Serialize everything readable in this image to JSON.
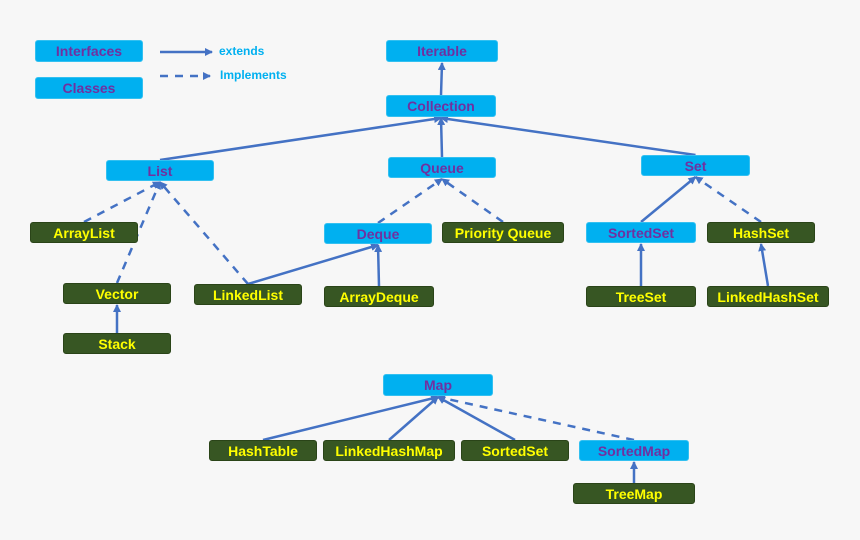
{
  "legend": {
    "interfaces_label": "Interfaces",
    "classes_label": "Classes",
    "extends_label": "extends",
    "implements_label": "Implements"
  },
  "colors": {
    "interface_fill": "#00b0f0",
    "interface_text": "#7030a0",
    "class_fill": "#375623",
    "class_text": "#ffff00",
    "arrow": "#4472c4",
    "legend_text": "#00b0f0"
  },
  "nodes": {
    "iterable": {
      "label": "Iterable",
      "kind": "interface"
    },
    "collection": {
      "label": "Collection",
      "kind": "interface"
    },
    "list": {
      "label": "List",
      "kind": "interface"
    },
    "queue": {
      "label": "Queue",
      "kind": "interface"
    },
    "set": {
      "label": "Set",
      "kind": "interface"
    },
    "arraylist": {
      "label": "ArrayList",
      "kind": "class"
    },
    "deque": {
      "label": "Deque",
      "kind": "interface"
    },
    "priorityqueue": {
      "label": "Priority Queue",
      "kind": "class"
    },
    "sortedset": {
      "label": "SortedSet",
      "kind": "interface"
    },
    "hashset": {
      "label": "HashSet",
      "kind": "class"
    },
    "vector": {
      "label": "Vector",
      "kind": "class"
    },
    "linkedlist": {
      "label": "LinkedList",
      "kind": "class"
    },
    "arraydeque": {
      "label": "ArrayDeque",
      "kind": "class"
    },
    "stack": {
      "label": "Stack",
      "kind": "class"
    },
    "treeset": {
      "label": "TreeSet",
      "kind": "class"
    },
    "linkedhashset": {
      "label": "LinkedHashSet",
      "kind": "class"
    },
    "map": {
      "label": "Map",
      "kind": "interface"
    },
    "hashtable": {
      "label": "HashTable",
      "kind": "class"
    },
    "linkedhashmap": {
      "label": "LinkedHashMap",
      "kind": "class"
    },
    "sortedset_map": {
      "label": "SortedSet",
      "kind": "class"
    },
    "sortedmap": {
      "label": "SortedMap",
      "kind": "interface"
    },
    "treemap": {
      "label": "TreeMap",
      "kind": "class"
    }
  },
  "edges": [
    {
      "from": "collection",
      "to": "iterable",
      "type": "extends"
    },
    {
      "from": "list",
      "to": "collection",
      "type": "extends"
    },
    {
      "from": "queue",
      "to": "collection",
      "type": "extends"
    },
    {
      "from": "set",
      "to": "collection",
      "type": "extends"
    },
    {
      "from": "arraylist",
      "to": "list",
      "type": "implements"
    },
    {
      "from": "vector",
      "to": "list",
      "type": "implements"
    },
    {
      "from": "linkedlist",
      "to": "list",
      "type": "implements"
    },
    {
      "from": "linkedlist",
      "to": "deque",
      "type": "extends"
    },
    {
      "from": "stack",
      "to": "vector",
      "type": "extends"
    },
    {
      "from": "deque",
      "to": "queue",
      "type": "implements"
    },
    {
      "from": "priorityqueue",
      "to": "queue",
      "type": "implements"
    },
    {
      "from": "arraydeque",
      "to": "deque",
      "type": "extends"
    },
    {
      "from": "sortedset",
      "to": "set",
      "type": "extends"
    },
    {
      "from": "hashset",
      "to": "set",
      "type": "implements"
    },
    {
      "from": "treeset",
      "to": "sortedset",
      "type": "extends"
    },
    {
      "from": "linkedhashset",
      "to": "hashset",
      "type": "extends"
    },
    {
      "from": "hashtable",
      "to": "map",
      "type": "extends"
    },
    {
      "from": "linkedhashmap",
      "to": "map",
      "type": "extends"
    },
    {
      "from": "sortedset_map",
      "to": "map",
      "type": "extends"
    },
    {
      "from": "sortedmap",
      "to": "map",
      "type": "implements"
    },
    {
      "from": "treemap",
      "to": "sortedmap",
      "type": "extends"
    }
  ]
}
